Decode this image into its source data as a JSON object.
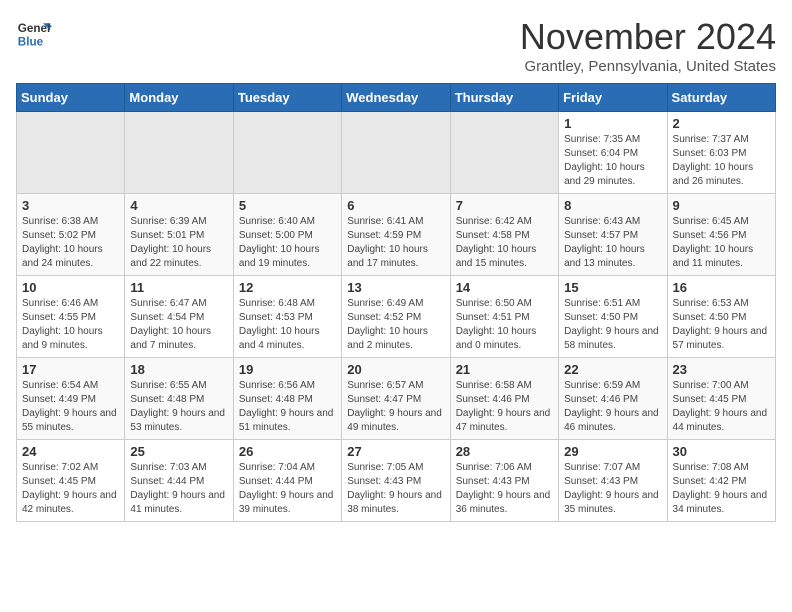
{
  "header": {
    "logo_line1": "General",
    "logo_line2": "Blue",
    "month": "November 2024",
    "location": "Grantley, Pennsylvania, United States"
  },
  "days_of_week": [
    "Sunday",
    "Monday",
    "Tuesday",
    "Wednesday",
    "Thursday",
    "Friday",
    "Saturday"
  ],
  "weeks": [
    [
      {
        "num": "",
        "info": ""
      },
      {
        "num": "",
        "info": ""
      },
      {
        "num": "",
        "info": ""
      },
      {
        "num": "",
        "info": ""
      },
      {
        "num": "",
        "info": ""
      },
      {
        "num": "1",
        "info": "Sunrise: 7:35 AM\nSunset: 6:04 PM\nDaylight: 10 hours and 29 minutes."
      },
      {
        "num": "2",
        "info": "Sunrise: 7:37 AM\nSunset: 6:03 PM\nDaylight: 10 hours and 26 minutes."
      }
    ],
    [
      {
        "num": "3",
        "info": "Sunrise: 6:38 AM\nSunset: 5:02 PM\nDaylight: 10 hours and 24 minutes."
      },
      {
        "num": "4",
        "info": "Sunrise: 6:39 AM\nSunset: 5:01 PM\nDaylight: 10 hours and 22 minutes."
      },
      {
        "num": "5",
        "info": "Sunrise: 6:40 AM\nSunset: 5:00 PM\nDaylight: 10 hours and 19 minutes."
      },
      {
        "num": "6",
        "info": "Sunrise: 6:41 AM\nSunset: 4:59 PM\nDaylight: 10 hours and 17 minutes."
      },
      {
        "num": "7",
        "info": "Sunrise: 6:42 AM\nSunset: 4:58 PM\nDaylight: 10 hours and 15 minutes."
      },
      {
        "num": "8",
        "info": "Sunrise: 6:43 AM\nSunset: 4:57 PM\nDaylight: 10 hours and 13 minutes."
      },
      {
        "num": "9",
        "info": "Sunrise: 6:45 AM\nSunset: 4:56 PM\nDaylight: 10 hours and 11 minutes."
      }
    ],
    [
      {
        "num": "10",
        "info": "Sunrise: 6:46 AM\nSunset: 4:55 PM\nDaylight: 10 hours and 9 minutes."
      },
      {
        "num": "11",
        "info": "Sunrise: 6:47 AM\nSunset: 4:54 PM\nDaylight: 10 hours and 7 minutes."
      },
      {
        "num": "12",
        "info": "Sunrise: 6:48 AM\nSunset: 4:53 PM\nDaylight: 10 hours and 4 minutes."
      },
      {
        "num": "13",
        "info": "Sunrise: 6:49 AM\nSunset: 4:52 PM\nDaylight: 10 hours and 2 minutes."
      },
      {
        "num": "14",
        "info": "Sunrise: 6:50 AM\nSunset: 4:51 PM\nDaylight: 10 hours and 0 minutes."
      },
      {
        "num": "15",
        "info": "Sunrise: 6:51 AM\nSunset: 4:50 PM\nDaylight: 9 hours and 58 minutes."
      },
      {
        "num": "16",
        "info": "Sunrise: 6:53 AM\nSunset: 4:50 PM\nDaylight: 9 hours and 57 minutes."
      }
    ],
    [
      {
        "num": "17",
        "info": "Sunrise: 6:54 AM\nSunset: 4:49 PM\nDaylight: 9 hours and 55 minutes."
      },
      {
        "num": "18",
        "info": "Sunrise: 6:55 AM\nSunset: 4:48 PM\nDaylight: 9 hours and 53 minutes."
      },
      {
        "num": "19",
        "info": "Sunrise: 6:56 AM\nSunset: 4:48 PM\nDaylight: 9 hours and 51 minutes."
      },
      {
        "num": "20",
        "info": "Sunrise: 6:57 AM\nSunset: 4:47 PM\nDaylight: 9 hours and 49 minutes."
      },
      {
        "num": "21",
        "info": "Sunrise: 6:58 AM\nSunset: 4:46 PM\nDaylight: 9 hours and 47 minutes."
      },
      {
        "num": "22",
        "info": "Sunrise: 6:59 AM\nSunset: 4:46 PM\nDaylight: 9 hours and 46 minutes."
      },
      {
        "num": "23",
        "info": "Sunrise: 7:00 AM\nSunset: 4:45 PM\nDaylight: 9 hours and 44 minutes."
      }
    ],
    [
      {
        "num": "24",
        "info": "Sunrise: 7:02 AM\nSunset: 4:45 PM\nDaylight: 9 hours and 42 minutes."
      },
      {
        "num": "25",
        "info": "Sunrise: 7:03 AM\nSunset: 4:44 PM\nDaylight: 9 hours and 41 minutes."
      },
      {
        "num": "26",
        "info": "Sunrise: 7:04 AM\nSunset: 4:44 PM\nDaylight: 9 hours and 39 minutes."
      },
      {
        "num": "27",
        "info": "Sunrise: 7:05 AM\nSunset: 4:43 PM\nDaylight: 9 hours and 38 minutes."
      },
      {
        "num": "28",
        "info": "Sunrise: 7:06 AM\nSunset: 4:43 PM\nDaylight: 9 hours and 36 minutes."
      },
      {
        "num": "29",
        "info": "Sunrise: 7:07 AM\nSunset: 4:43 PM\nDaylight: 9 hours and 35 minutes."
      },
      {
        "num": "30",
        "info": "Sunrise: 7:08 AM\nSunset: 4:42 PM\nDaylight: 9 hours and 34 minutes."
      }
    ]
  ]
}
